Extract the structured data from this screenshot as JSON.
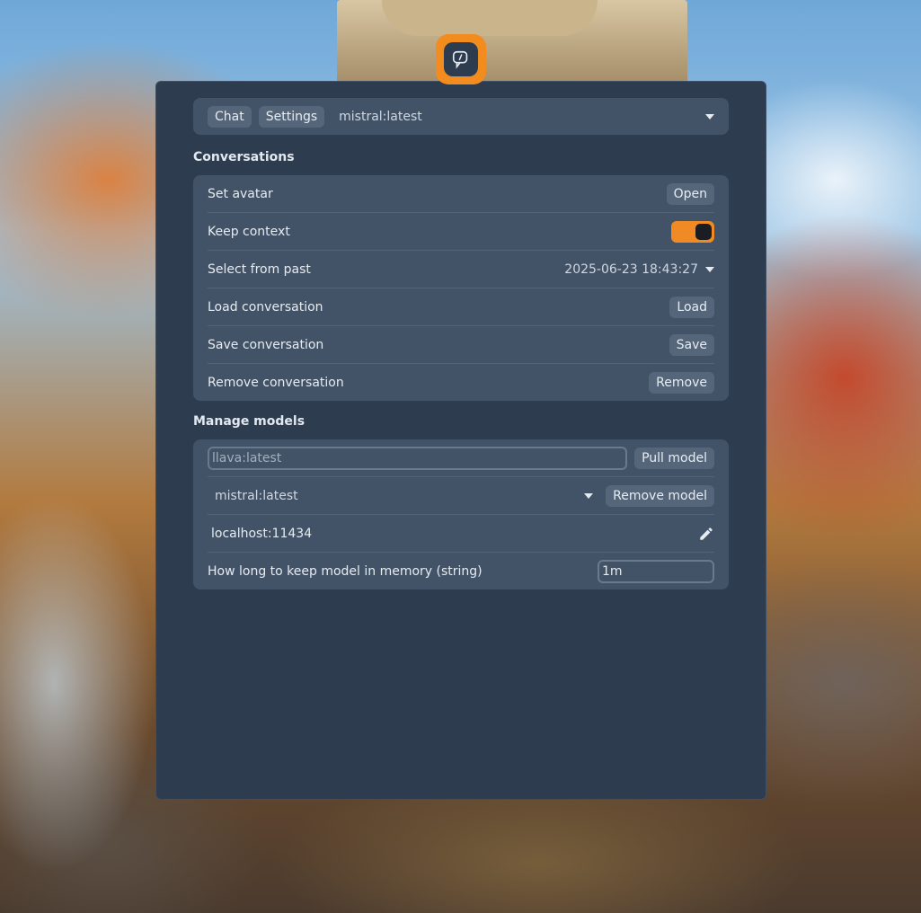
{
  "header": {
    "tabs": [
      "Chat",
      "Settings"
    ],
    "selected_model": "mistral:latest"
  },
  "conversations": {
    "title": "Conversations",
    "rows": {
      "set_avatar": {
        "label": "Set avatar",
        "button": "Open"
      },
      "keep_context": {
        "label": "Keep context",
        "enabled": true
      },
      "select_from_past": {
        "label": "Select from past",
        "value": "2025-06-23 18:43:27"
      },
      "load": {
        "label": "Load conversation",
        "button": "Load"
      },
      "save": {
        "label": "Save conversation",
        "button": "Save"
      },
      "remove": {
        "label": "Remove conversation",
        "button": "Remove"
      }
    }
  },
  "manage_models": {
    "title": "Manage models",
    "pull_input_placeholder": "llava:latest",
    "pull_button": "Pull model",
    "model_select_value": "mistral:latest",
    "remove_button": "Remove model",
    "host": "localhost:11434",
    "keep_alive_label": "How long to keep model in memory (string)",
    "keep_alive_value": "1m"
  },
  "colors": {
    "accent": "#f08a24",
    "window_bg": "#2e3c4f",
    "card_bg": "#435367"
  },
  "icons": {
    "app": "chat-bubble-icon",
    "dropdown": "caret-down-icon",
    "edit": "pencil-icon"
  }
}
